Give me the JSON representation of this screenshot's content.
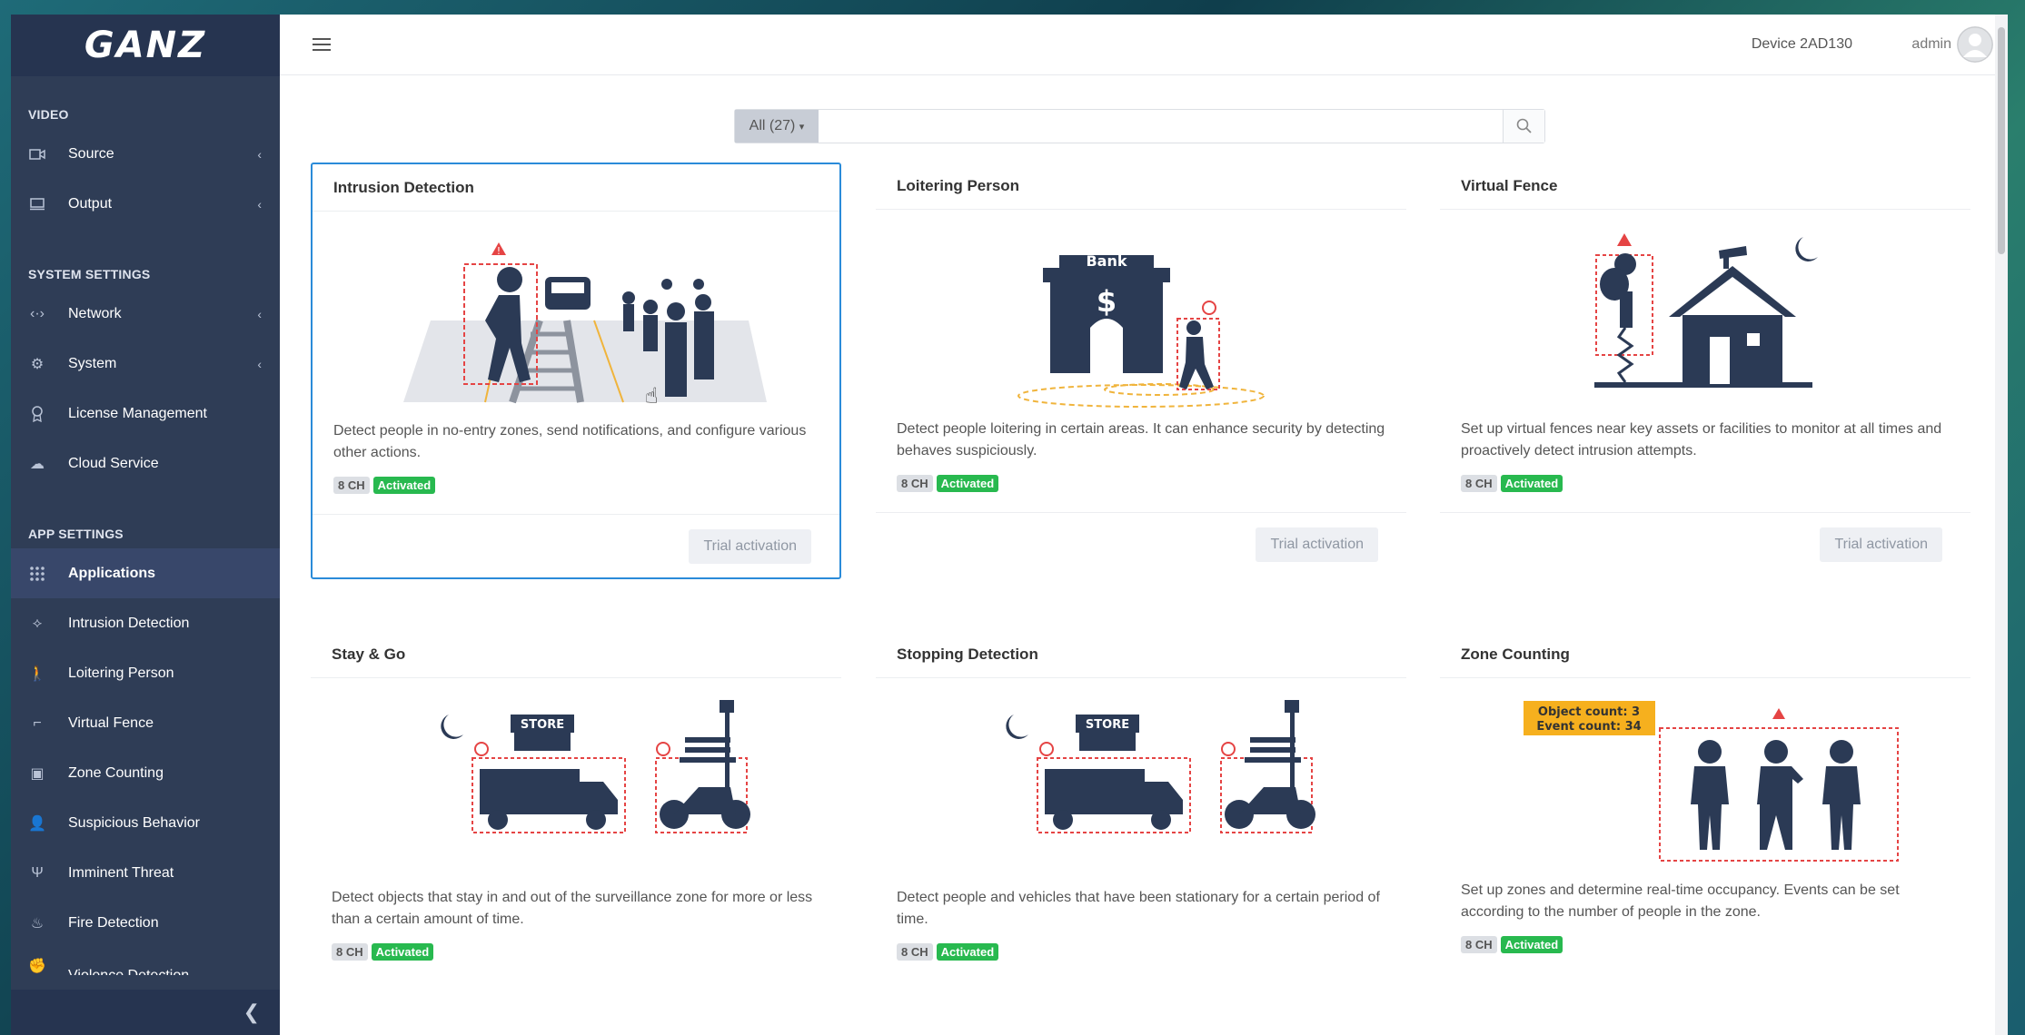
{
  "brand": {
    "logo_text": "GANZ"
  },
  "header": {
    "device": "Device 2AD130",
    "user": "admin"
  },
  "sidebar": {
    "sections": {
      "video": "VIDEO",
      "system": "SYSTEM SETTINGS",
      "app": "APP SETTINGS"
    },
    "items": [
      {
        "label": "Source"
      },
      {
        "label": "Output"
      },
      {
        "label": "Network"
      },
      {
        "label": "System"
      },
      {
        "label": "License Management"
      },
      {
        "label": "Cloud Service"
      },
      {
        "label": "Applications"
      },
      {
        "label": "Intrusion Detection"
      },
      {
        "label": "Loitering Person"
      },
      {
        "label": "Virtual Fence"
      },
      {
        "label": "Zone Counting"
      },
      {
        "label": "Suspicious Behavior"
      },
      {
        "label": "Imminent Threat"
      },
      {
        "label": "Fire Detection"
      },
      {
        "label": "Violence Detection"
      }
    ]
  },
  "search": {
    "filter_label": "All (27)",
    "placeholder": ""
  },
  "cards": [
    {
      "title": "Intrusion Detection",
      "desc": "Detect people in no-entry zones, send notifications, and configure various other actions.",
      "channels": "8 CH",
      "status": "Activated",
      "action": "Trial activation"
    },
    {
      "title": "Loitering Person",
      "desc": "Detect people loitering in certain areas. It can enhance security by detecting behaves suspiciously.",
      "channels": "8 CH",
      "status": "Activated",
      "action": "Trial activation"
    },
    {
      "title": "Virtual Fence",
      "desc": "Set up virtual fences near key assets or facilities to monitor at all times and proactively detect intrusion attempts.",
      "channels": "8 CH",
      "status": "Activated",
      "action": "Trial activation"
    },
    {
      "title": "Stay & Go",
      "desc": "Detect objects that stay in and out of the surveillance zone for more or less than a certain amount of time.",
      "channels": "8 CH",
      "status": "Activated"
    },
    {
      "title": "Stopping Detection",
      "desc": "Detect people and vehicles that have been stationary for a certain period of time.",
      "channels": "8 CH",
      "status": "Activated"
    },
    {
      "title": "Zone Counting",
      "desc": "Set up zones and determine real-time occupancy. Events can be set according to the number of people in the zone.",
      "channels": "8 CH",
      "status": "Activated",
      "overlay": {
        "object_count": "Object count: 3",
        "event_count": "Event count: 34"
      }
    }
  ],
  "illustration_text": {
    "bank": "Bank",
    "store": "STORE"
  },
  "colors": {
    "sidebar": "#2f3d56",
    "accent": "#2a8bd9",
    "activated": "#28b94f",
    "illustration": "#2b3a55"
  }
}
